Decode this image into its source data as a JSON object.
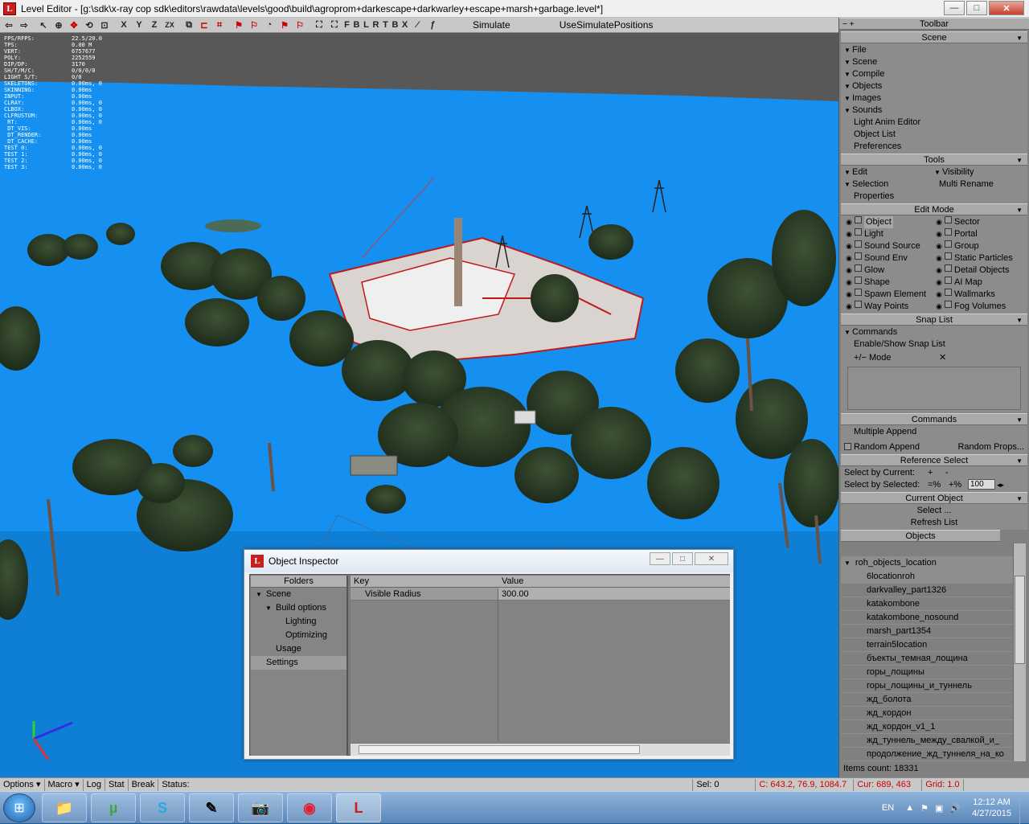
{
  "window": {
    "title": "Level Editor - [g:\\sdk\\x-ray cop sdk\\editors\\rawdata\\levels\\good\\build\\agroprom+darkescape+darkwarley+escape+marsh+garbage.level*]",
    "min": "—",
    "max": "□",
    "close": "✕"
  },
  "toolbar": {
    "letters": [
      "F",
      "B",
      "L",
      "R",
      "T",
      "B",
      "X"
    ],
    "axes": [
      "X",
      "Y",
      "Z",
      "ZX"
    ],
    "simulate": "Simulate",
    "use_sim": "UseSimulatePositions"
  },
  "stats": [
    [
      "FPS/RFPS:",
      "22.5/20.0"
    ],
    [
      "TPS:",
      "0.00 M"
    ],
    [
      "VERT:",
      "6757677"
    ],
    [
      "POLY:",
      "2252559"
    ],
    [
      "DIP/DP:",
      "3170"
    ],
    [
      "SH/T/M/C:",
      "0/0/0/0"
    ],
    [
      "LIGHT S/T:",
      "0/0"
    ],
    [
      "SKELETONS:",
      "0.00ms, 0"
    ],
    [
      "SKINNING:",
      "0.00ms"
    ],
    [
      "",
      ""
    ],
    [
      "INPUT:",
      "0.00ms"
    ],
    [
      "CLRAY:",
      "0.00ms, 0"
    ],
    [
      "CLBOX:",
      "0.00ms, 0"
    ],
    [
      "CLFRUSTUM:",
      "0.00ms, 0"
    ],
    [
      "",
      ""
    ],
    [
      " RT:",
      "0.00ms, 0"
    ],
    [
      " DT_VIS:",
      "0.00ms"
    ],
    [
      " DT_RENDER:",
      "0.00ms"
    ],
    [
      " DT_CACHE:",
      "0.00ms"
    ],
    [
      "",
      ""
    ],
    [
      "TEST 0:",
      "0.00ms, 0"
    ],
    [
      "TEST 1:",
      "0.00ms, 0"
    ],
    [
      "TEST 2:",
      "0.00ms, 0"
    ],
    [
      "TEST 3:",
      "0.00ms, 0"
    ]
  ],
  "panel": {
    "toolbar_title": "Toolbar",
    "toolbar_minus": "−",
    "toolbar_plus": "+",
    "scene_title": "Scene",
    "scene_items": [
      "File",
      "Scene",
      "Compile",
      "Objects",
      "Images",
      "Sounds"
    ],
    "scene_plain": [
      "Light Anim Editor",
      "Object List",
      "Preferences"
    ],
    "tools_title": "Tools",
    "tools_edit": "Edit",
    "tools_visibility": "Visibility",
    "tools_selection": "Selection",
    "tools_multi_rename": "Multi Rename",
    "tools_properties": "Properties",
    "editmode_title": "Edit Mode",
    "editmode_left": [
      "Object",
      "Light",
      "Sound Source",
      "Sound Env",
      "Glow",
      "Shape",
      "Spawn Element",
      "Way Points"
    ],
    "editmode_right": [
      "Sector",
      "Portal",
      "Group",
      "Static Particles",
      "Detail Objects",
      "AI Map",
      "Wallmarks",
      "Fog Volumes"
    ],
    "snap_title": "Snap List",
    "snap_commands": "Commands",
    "snap_enable": "Enable/Show Snap List",
    "snap_mode": "+/− Mode",
    "snap_x": "✕",
    "commands_title": "Commands",
    "multiple_append": "Multiple Append",
    "random_append": "Random Append",
    "random_props": "Random Props...",
    "refsel_title": "Reference Select",
    "select_by_current": "Select by Current:",
    "select_by_selected": "Select by Selected:",
    "plus": "+",
    "minus": "-",
    "eq_pct": "=%",
    "plus_pct": "+%",
    "pct_value": "100",
    "curobj_title": "Current Object",
    "select": "Select ...",
    "refresh_list": "Refresh List",
    "objects_title": "Objects",
    "objects_root": "roh_objects_location",
    "objects": [
      "6locationroh",
      "darkvalley_part1326",
      "katakombone",
      "katakombone_nosound",
      "marsh_part1354",
      "terrain5location",
      "бъекты_темная_лощина",
      "горы_лощины",
      "горы_лощины_и_туннель",
      "жд_болота",
      "жд_кордон",
      "жд_кордон_v1_1",
      "жд_туннель_между_свалкой_и_",
      "продолжение_жд_туннеля_на_ко"
    ],
    "items_count": "Items count: 18331"
  },
  "inspector": {
    "title": "Object Inspector",
    "folders_header": "Folders",
    "folders": [
      {
        "label": "Scene",
        "lvl": 0,
        "arrow": "▼"
      },
      {
        "label": "Build options",
        "lvl": 1,
        "arrow": "▼"
      },
      {
        "label": "Lighting",
        "lvl": 2,
        "arrow": ""
      },
      {
        "label": "Optimizing",
        "lvl": 2,
        "arrow": ""
      },
      {
        "label": "Usage",
        "lvl": 1,
        "arrow": ""
      },
      {
        "label": "Settings",
        "lvl": 0,
        "arrow": "",
        "sel": true
      }
    ],
    "key_header": "Key",
    "value_header": "Value",
    "row_key": "Visible Radius",
    "row_value": "300.00"
  },
  "status": {
    "options": "Options",
    "macro": "Macro",
    "log": "Log",
    "stat": "Stat",
    "break": "Break",
    "status_label": "Status:",
    "sel": "Sel: 0",
    "coords": "C: 643.2, 76.9, 1084.7",
    "cur": "Cur: 689, 463",
    "grid": "Grid: 1.0"
  },
  "taskbar": {
    "lang": "EN",
    "time": "12:12 AM",
    "date": "4/27/2015",
    "apps": [
      "folder-icon",
      "utorrent-icon",
      "skype-icon",
      "editor-icon",
      "camera-icon",
      "chrome-icon",
      "level-editor-icon"
    ],
    "app_glyphs": [
      "📁",
      "µ",
      "S",
      "✎",
      "📷",
      "◉",
      "L"
    ]
  },
  "colors": {
    "water": "#1590f0",
    "panel": "#808080",
    "header": "#a9a9a9",
    "accent_red": "#c81e1e"
  }
}
